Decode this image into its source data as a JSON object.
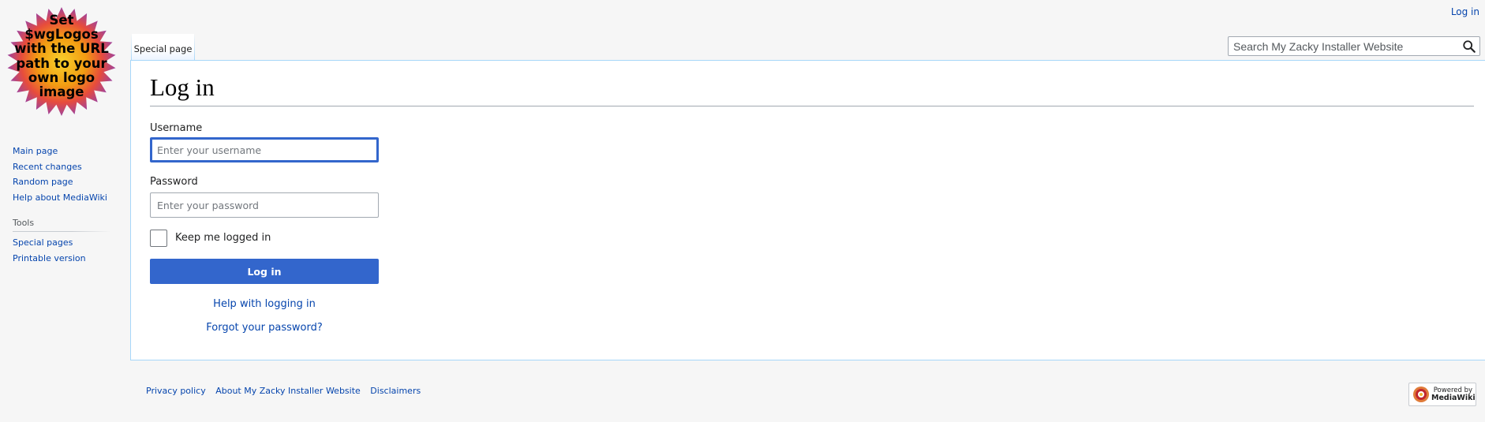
{
  "logo": {
    "text": "Set\n$wgLogos\nwith the URL\npath to your\nown logo\nimage",
    "colors": [
      "#e8372c",
      "#f5a623",
      "#c0392b",
      "#9b59b6"
    ]
  },
  "personal": {
    "login_link": "Log in"
  },
  "tabs": [
    {
      "label": "Special page"
    }
  ],
  "search": {
    "placeholder": "Search My Zacky Installer Website",
    "icon": "search-icon"
  },
  "page": {
    "title": "Log in",
    "username_label": "Username",
    "username_placeholder": "Enter your username",
    "password_label": "Password",
    "password_placeholder": "Enter your password",
    "remember_label": "Keep me logged in",
    "login_button": "Log in",
    "help_link": "Help with logging in",
    "forgot_link": "Forgot your password?"
  },
  "sidebar": {
    "navigation": [
      {
        "label": "Main page"
      },
      {
        "label": "Recent changes"
      },
      {
        "label": "Random page"
      },
      {
        "label": "Help about MediaWiki"
      }
    ],
    "tools_heading": "Tools",
    "tools": [
      {
        "label": "Special pages"
      },
      {
        "label": "Printable version"
      }
    ]
  },
  "footer": {
    "links": [
      {
        "label": "Privacy policy"
      },
      {
        "label": "About My Zacky Installer Website"
      },
      {
        "label": "Disclaimers"
      }
    ],
    "powered_by": {
      "line1": "Powered by",
      "line2": "MediaWiki"
    }
  },
  "colors": {
    "link": "#0645ad",
    "primary_button": "#3366cc",
    "content_border": "#a7d7f9",
    "page_background": "#f6f6f6"
  }
}
